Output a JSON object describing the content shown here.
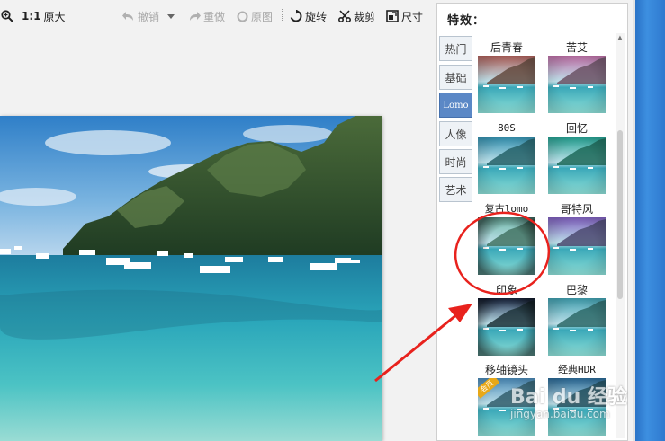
{
  "toolbar": {
    "zoom_label": "1:1",
    "original_size": "原大",
    "undo": "撤销",
    "redo": "重做",
    "original_image": "原图",
    "rotate": "旋转",
    "crop": "裁剪",
    "size": "尺寸"
  },
  "panel": {
    "title": "特效：",
    "categories": [
      "热门",
      "基础",
      "Lomo",
      "人像",
      "时尚",
      "艺术"
    ],
    "active_category": "Lomo",
    "effects": [
      {
        "label": "后青春",
        "tint": "#b0605a"
      },
      {
        "label": "苦艾",
        "tint": "#c070a8"
      },
      {
        "label": "80S",
        "tint": "#3090b0"
      },
      {
        "label": "回忆",
        "tint": "#20a090"
      },
      {
        "label": "复古lomo",
        "tint": "#70b8a8"
      },
      {
        "label": "哥特风",
        "tint": "#8060c0"
      },
      {
        "label": "印象",
        "tint": "#203050"
      },
      {
        "label": "巴黎",
        "tint": "#40a0b0"
      },
      {
        "label": "移轴镜头",
        "tint": "#4a8ab8"
      },
      {
        "label": "经典HDR",
        "tint": "#2a6a98"
      }
    ],
    "vip_badge": "会员"
  },
  "watermark": {
    "line1": "Bai du 经验",
    "line2": "jingyan.baidu.com"
  },
  "colors": {
    "active_tab": "#5b88c6",
    "annotation_red": "#e8221d",
    "desktop_blue": "#2e7dd4"
  }
}
